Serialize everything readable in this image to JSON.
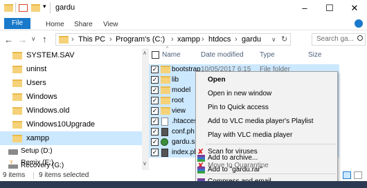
{
  "window": {
    "title": "gardu",
    "title_icons": [
      "checkbox-icon",
      "folder-icon",
      "quick-access-dropdown-icon"
    ],
    "minimize": "–",
    "maximize": "☐",
    "close": "✕"
  },
  "ribbon": {
    "tabs": [
      "File",
      "Home",
      "Share",
      "View"
    ],
    "help_icon": "help-icon"
  },
  "address": {
    "back": "←",
    "forward": "→",
    "recent": "∨",
    "up": "↑",
    "path": [
      "This PC",
      "Program's (C:)",
      "xampp",
      "htdocs",
      "gardu"
    ],
    "separator": "›",
    "dropdown": "∨",
    "refresh": "↻"
  },
  "search": {
    "placeholder": "Search ga...",
    "icon": "search-icon"
  },
  "nav": {
    "items": [
      {
        "label": "SYSTEM.SAV",
        "icon": "folder-icon"
      },
      {
        "label": "uninst",
        "icon": "folder-icon"
      },
      {
        "label": "Users",
        "icon": "folder-icon"
      },
      {
        "label": "Windows",
        "icon": "folder-icon"
      },
      {
        "label": "Windows.old",
        "icon": "folder-icon"
      },
      {
        "label": "Windows10Upgrade",
        "icon": "folder-icon"
      },
      {
        "label": "xampp",
        "icon": "folder-icon",
        "selected": true
      },
      {
        "label": "Setup (D:)",
        "icon": "drive-icon"
      },
      {
        "label": "Remix (E:)",
        "icon": "remix-drive-icon"
      },
      {
        "label": "Recovery (G:)",
        "icon": "drive-icon"
      }
    ]
  },
  "columns": {
    "name": "Name",
    "date": "Date modified",
    "type": "Type",
    "size": "Size"
  },
  "files": [
    {
      "name": "bootstrap",
      "date": "10/05/2017 6:15",
      "type": "File folder"
    },
    {
      "name": "lib"
    },
    {
      "name": "model"
    },
    {
      "name": "root"
    },
    {
      "name": "view"
    },
    {
      "name": ".htacces"
    },
    {
      "name": "conf.ph"
    },
    {
      "name": "gardu.sc"
    },
    {
      "name": "index.ph"
    }
  ],
  "context_menu": {
    "items": [
      "Open",
      "Open in new window",
      "Pin to Quick access",
      "Add to VLC media player's Playlist",
      "Play with VLC media player",
      "Scan for viruses",
      "Move to Quarantine",
      "Add to archive...",
      "Add to \"gardu.rar\"",
      "Compress and email..."
    ]
  },
  "status": {
    "count": "9 items",
    "selected": "9 items selected"
  },
  "colors": {
    "accent": "#1979ca",
    "selection": "#cce8ff",
    "folder": "#f5d279"
  }
}
